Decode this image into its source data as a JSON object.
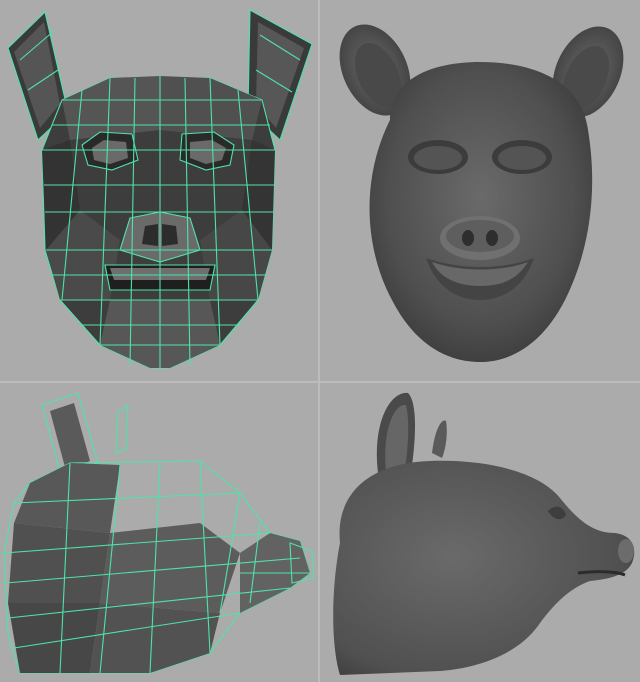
{
  "viewports": [
    {
      "name": "front-wireframe",
      "label": "",
      "mode": "wireframe-on-shaded"
    },
    {
      "name": "front-smooth",
      "label": "",
      "mode": "smooth-shaded"
    },
    {
      "name": "side-wireframe",
      "label": "",
      "mode": "wireframe-on-shaded"
    },
    {
      "name": "side-smooth",
      "label": "",
      "mode": "smooth-shaded"
    }
  ],
  "colors": {
    "viewport_bg": "#ababab",
    "divider": "#bcbcbc",
    "wireframe": "#4fe3a8",
    "mesh_dark": "#2f2f2f",
    "mesh_mid": "#555555",
    "mesh_light": "#6e6e6e"
  }
}
